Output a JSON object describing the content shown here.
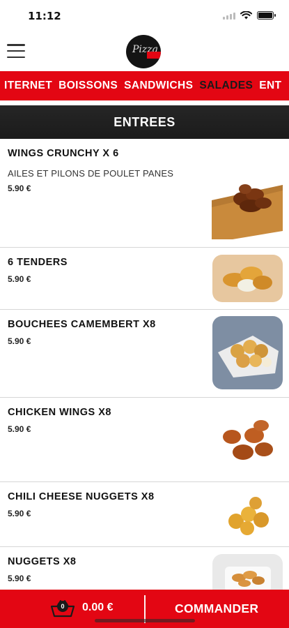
{
  "status_bar": {
    "time": "11:12"
  },
  "header": {
    "menu_icon": "hamburger-menu-icon",
    "logo_text": "Pizza"
  },
  "categories": [
    {
      "label": "ITERNET",
      "active": false
    },
    {
      "label": "BOISSONS",
      "active": false
    },
    {
      "label": "SANDWICHS",
      "active": false
    },
    {
      "label": "SALADES",
      "active": true
    },
    {
      "label": "ENT",
      "active": false
    }
  ],
  "section": {
    "title": "ENTREES"
  },
  "products": [
    {
      "name": "WINGS CRUNCHY X 6",
      "description": "AILES ET PILONS DE POULET PANES",
      "price": "5.90 €"
    },
    {
      "name": "6 TENDERS",
      "description": "",
      "price": "5.90 €"
    },
    {
      "name": "BOUCHEES CAMEMBERT X8",
      "description": "",
      "price": "5.90 €"
    },
    {
      "name": "CHICKEN WINGS X8",
      "description": "",
      "price": "5.90 €"
    },
    {
      "name": "CHILI CHEESE NUGGETS X8",
      "description": "",
      "price": "5.90 €"
    },
    {
      "name": "NUGGETS X8",
      "description": "",
      "price": "5.90 €"
    }
  ],
  "cart": {
    "count": "0",
    "total": "0.00 €",
    "icon": "basket-icon"
  },
  "order_button": {
    "label": "COMMANDER"
  },
  "colors": {
    "brand_red": "#e30613",
    "header_dark": "#1f1f1f"
  }
}
